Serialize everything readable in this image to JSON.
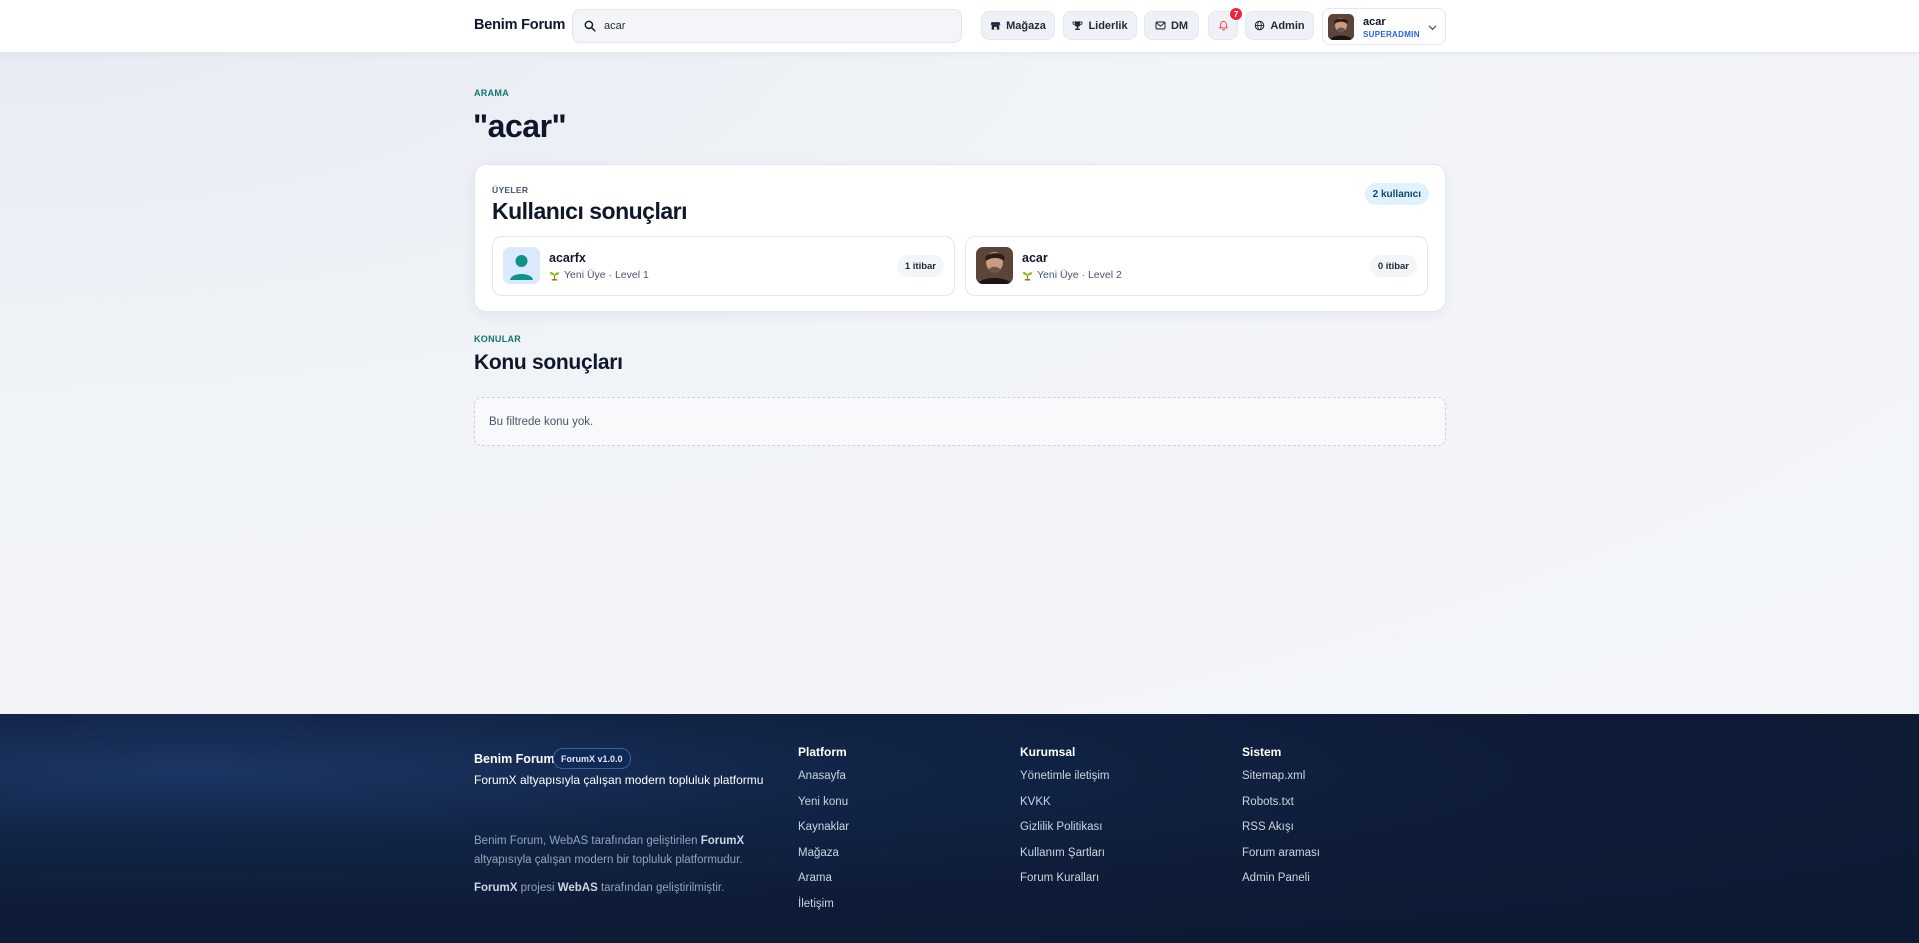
{
  "header": {
    "brand": "Benim Forum",
    "search_value": "acar",
    "nav": {
      "store": "Mağaza",
      "leaderboard": "Liderlik",
      "dm": "DM",
      "notifications_count": "7",
      "admin": "Admin"
    },
    "user": {
      "name": "acar",
      "role": "SUPERADMIN"
    }
  },
  "main": {
    "eyebrow": "ARAMA",
    "query_title": "\"acar\"",
    "members": {
      "eyebrow": "ÜYELER",
      "title": "Kullanıcı sonuçları",
      "count": "2 kullanıcı",
      "users": [
        {
          "name": "acarfx",
          "level": "Yeni Üye · Level 1",
          "reputation": "1 itibar"
        },
        {
          "name": "acar",
          "level": "Yeni Üye · Level 2",
          "reputation": "0 itibar"
        }
      ]
    },
    "topics": {
      "eyebrow": "KONULAR",
      "title": "Konu sonuçları",
      "empty": "Bu filtrede konu yok."
    }
  },
  "footer": {
    "brand": "Benim Forum",
    "version": "ForumX v1.0.0",
    "tagline": "ForumX altyapısıyla çalışan modern topluluk platformu",
    "description_parts": [
      "Benim Forum, WebAS tarafından geliştirilen ",
      "ForumX",
      " altyapısıyla çalışan modern bir topluluk platformudur."
    ],
    "credit_parts": [
      "ForumX",
      " projesi ",
      "WebAS",
      " tarafından geliştirilmiştir."
    ],
    "columns": [
      {
        "title": "Platform",
        "links": [
          "Anasayfa",
          "Yeni konu",
          "Kaynaklar",
          "Mağaza",
          "Arama",
          "İletişim"
        ]
      },
      {
        "title": "Kurumsal",
        "links": [
          "Yönetimle iletişim",
          "KVKK",
          "Gizlilik Politikası",
          "Kullanım Şartları",
          "Forum Kuralları"
        ]
      },
      {
        "title": "Sistem",
        "links": [
          "Sitemap.xml",
          "Robots.txt",
          "RSS Akışı",
          "Forum araması",
          "Admin Paneli"
        ]
      }
    ]
  },
  "colors": {
    "accent_teal": "#0f766e",
    "role_blue": "#2563eb",
    "badge_red": "#ef233c",
    "footer_bg": "#0c1a33"
  },
  "icons": [
    "search-icon",
    "store-icon",
    "trophy-icon",
    "mail-icon",
    "bell-icon",
    "globe-icon",
    "chevron-down-icon",
    "seedling-icon",
    "default-avatar-icon"
  ]
}
